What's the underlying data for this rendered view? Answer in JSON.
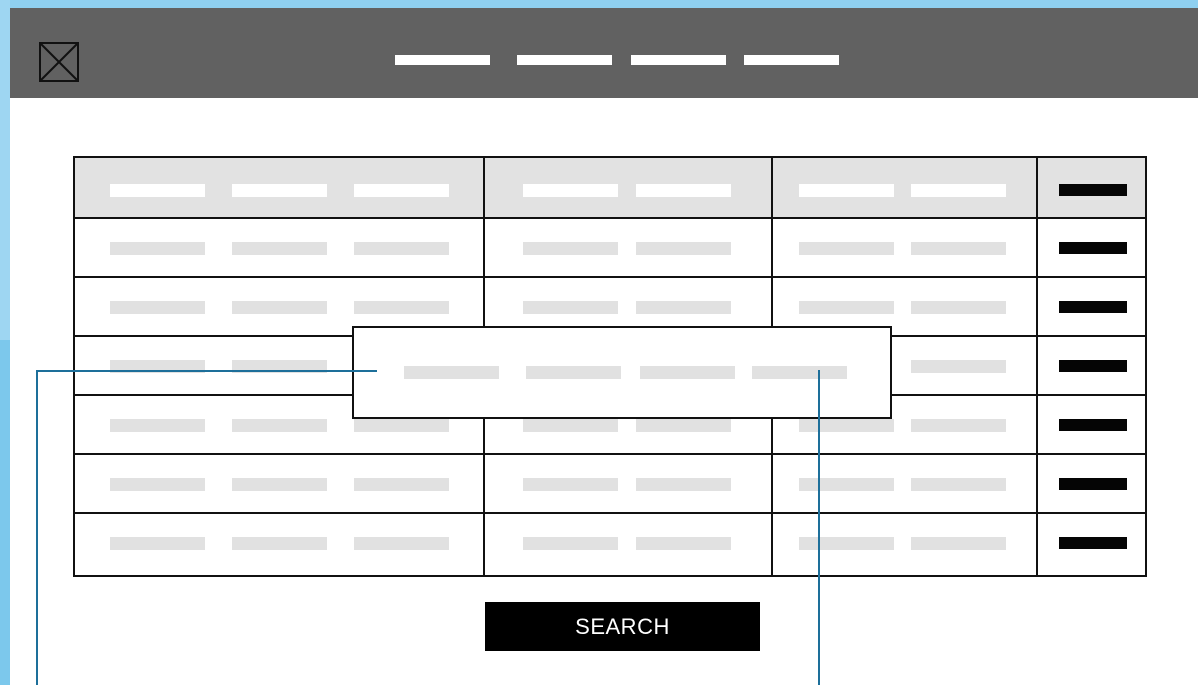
{
  "header": {
    "logo_icon": "image-placeholder-icon",
    "nav_items": [
      "",
      "",
      "",
      ""
    ]
  },
  "table": {
    "header_row": {
      "columns": 4
    },
    "body_rows": 6
  },
  "popover": {
    "text_placeholders": 4
  },
  "search_button": {
    "label": "SEARCH"
  },
  "colors": {
    "background": "#7cc8ec",
    "header": "#616161",
    "table_header": "#e2e2e2",
    "placeholder_text": "#e1e1e1",
    "action": "#050505",
    "annotation": "#1d6f9a"
  }
}
